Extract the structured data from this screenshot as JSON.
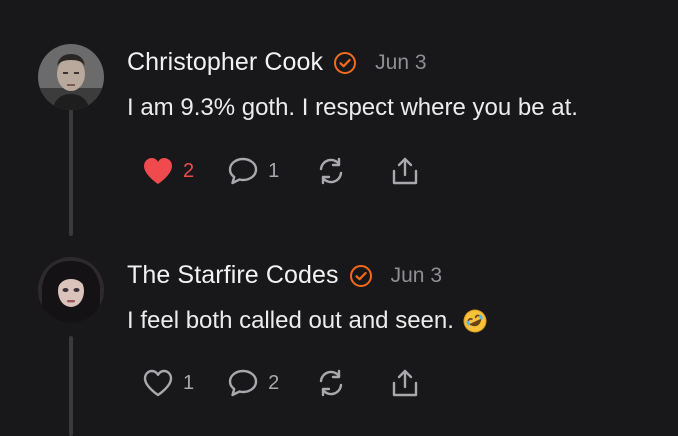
{
  "comments": [
    {
      "author": "Christopher Cook",
      "date": "Jun 3",
      "text": "I am 9.3% goth. I respect where you be at.",
      "emoji": "",
      "likes": "2",
      "liked": true,
      "replies": "1"
    },
    {
      "author": "The Starfire Codes",
      "date": "Jun 3",
      "text": "I feel both called out and seen.",
      "emoji": "rofl-emoji",
      "likes": "1",
      "liked": false,
      "replies": "2"
    }
  ],
  "colors": {
    "background": "#18181a",
    "accent": "#f26b1d",
    "like_red": "#f04a4e",
    "muted": "#8e8e93"
  },
  "icons": [
    "verified-badge-icon",
    "heart-icon",
    "comment-icon",
    "restack-icon",
    "share-icon"
  ]
}
